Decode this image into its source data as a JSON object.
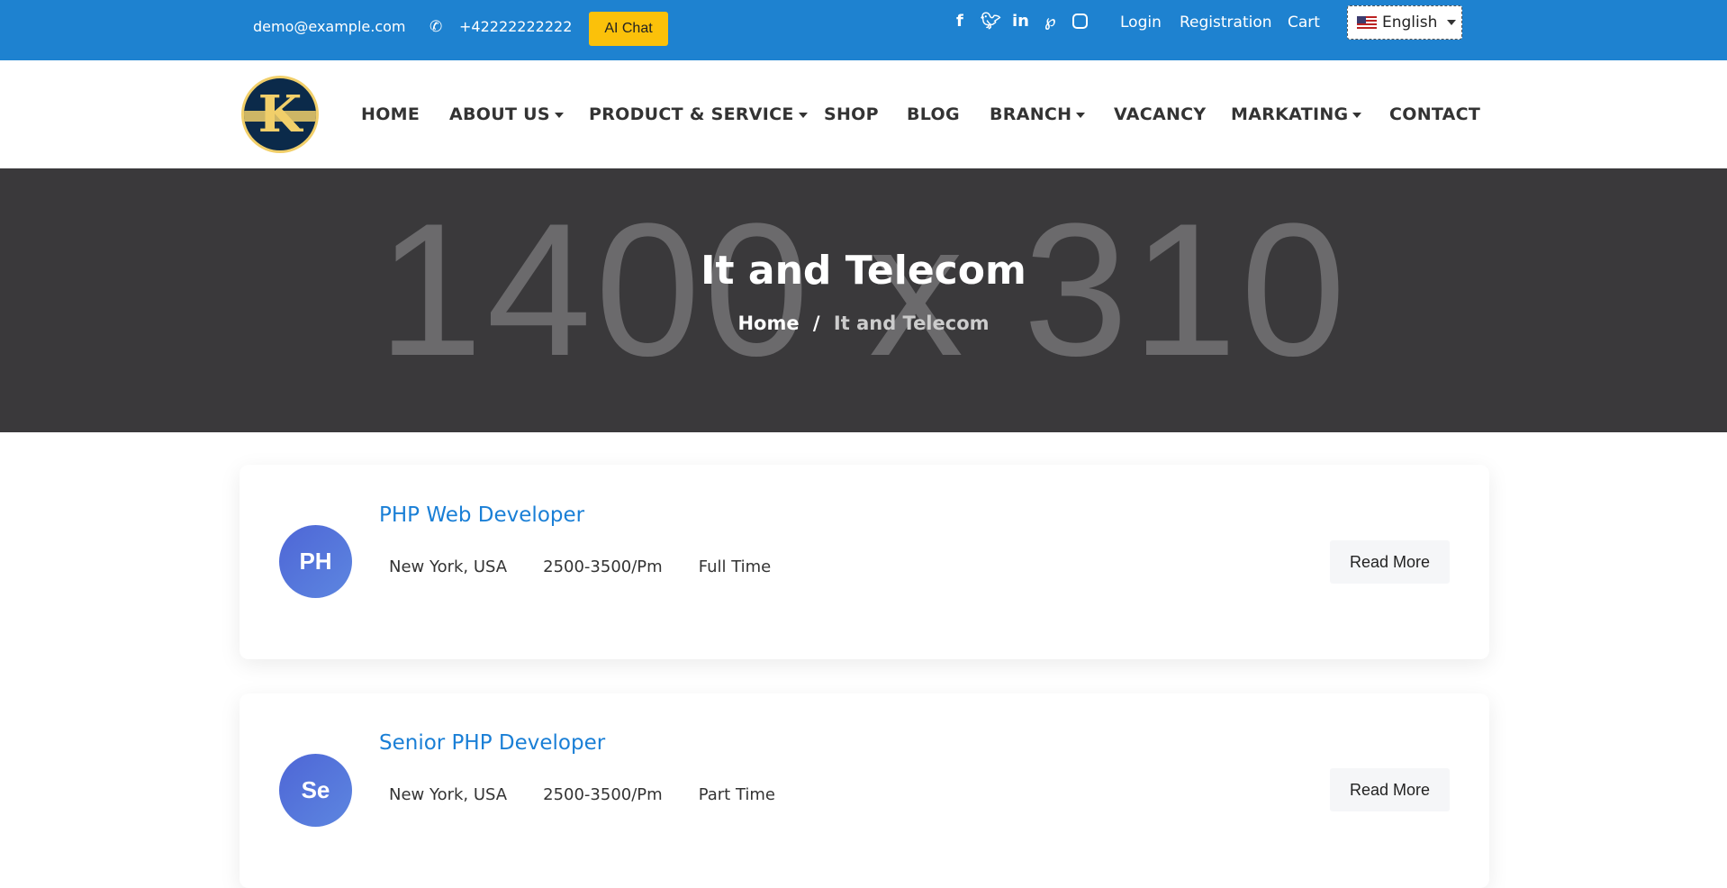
{
  "topbar": {
    "email": "demo@example.com",
    "phone": "+42222222222",
    "ai_chat": "AI Chat",
    "social": [
      "f",
      "t",
      "in",
      "p",
      "ig"
    ],
    "login": "Login",
    "registration": "Registration",
    "cart": "Cart",
    "language": "English"
  },
  "nav": {
    "logo_text": "K",
    "items": [
      {
        "label": "HOME"
      },
      {
        "label": "ABOUT US",
        "dropdown": true
      },
      {
        "label": "PRODUCT & SERVICE",
        "dropdown": true
      },
      {
        "label": "SHOP"
      },
      {
        "label": "BLOG"
      },
      {
        "label": "BRANCH",
        "dropdown": true
      },
      {
        "label": "VACANCY"
      },
      {
        "label": "MARKATING",
        "dropdown": true
      },
      {
        "label": "CONTACT"
      }
    ]
  },
  "banner": {
    "placeholder": "1400 x 310",
    "title": "It and Telecom",
    "breadcrumb_home": "Home",
    "breadcrumb_sep": "/",
    "breadcrumb_current": "It and Telecom"
  },
  "jobs": [
    {
      "initials": "PH",
      "title": "PHP Web Developer",
      "location": "New York, USA",
      "salary": "2500-3500/Pm",
      "type": "Full Time",
      "button": "Read More"
    },
    {
      "initials": "Se",
      "title": "Senior PHP Developer",
      "location": "New York, USA",
      "salary": "2500-3500/Pm",
      "type": "Part Time",
      "button": "Read More"
    }
  ],
  "colors": {
    "topbar": "#1e82d0",
    "accent": "#fbc10a",
    "link": "#1a7fd6",
    "banner": "#3a393b"
  }
}
